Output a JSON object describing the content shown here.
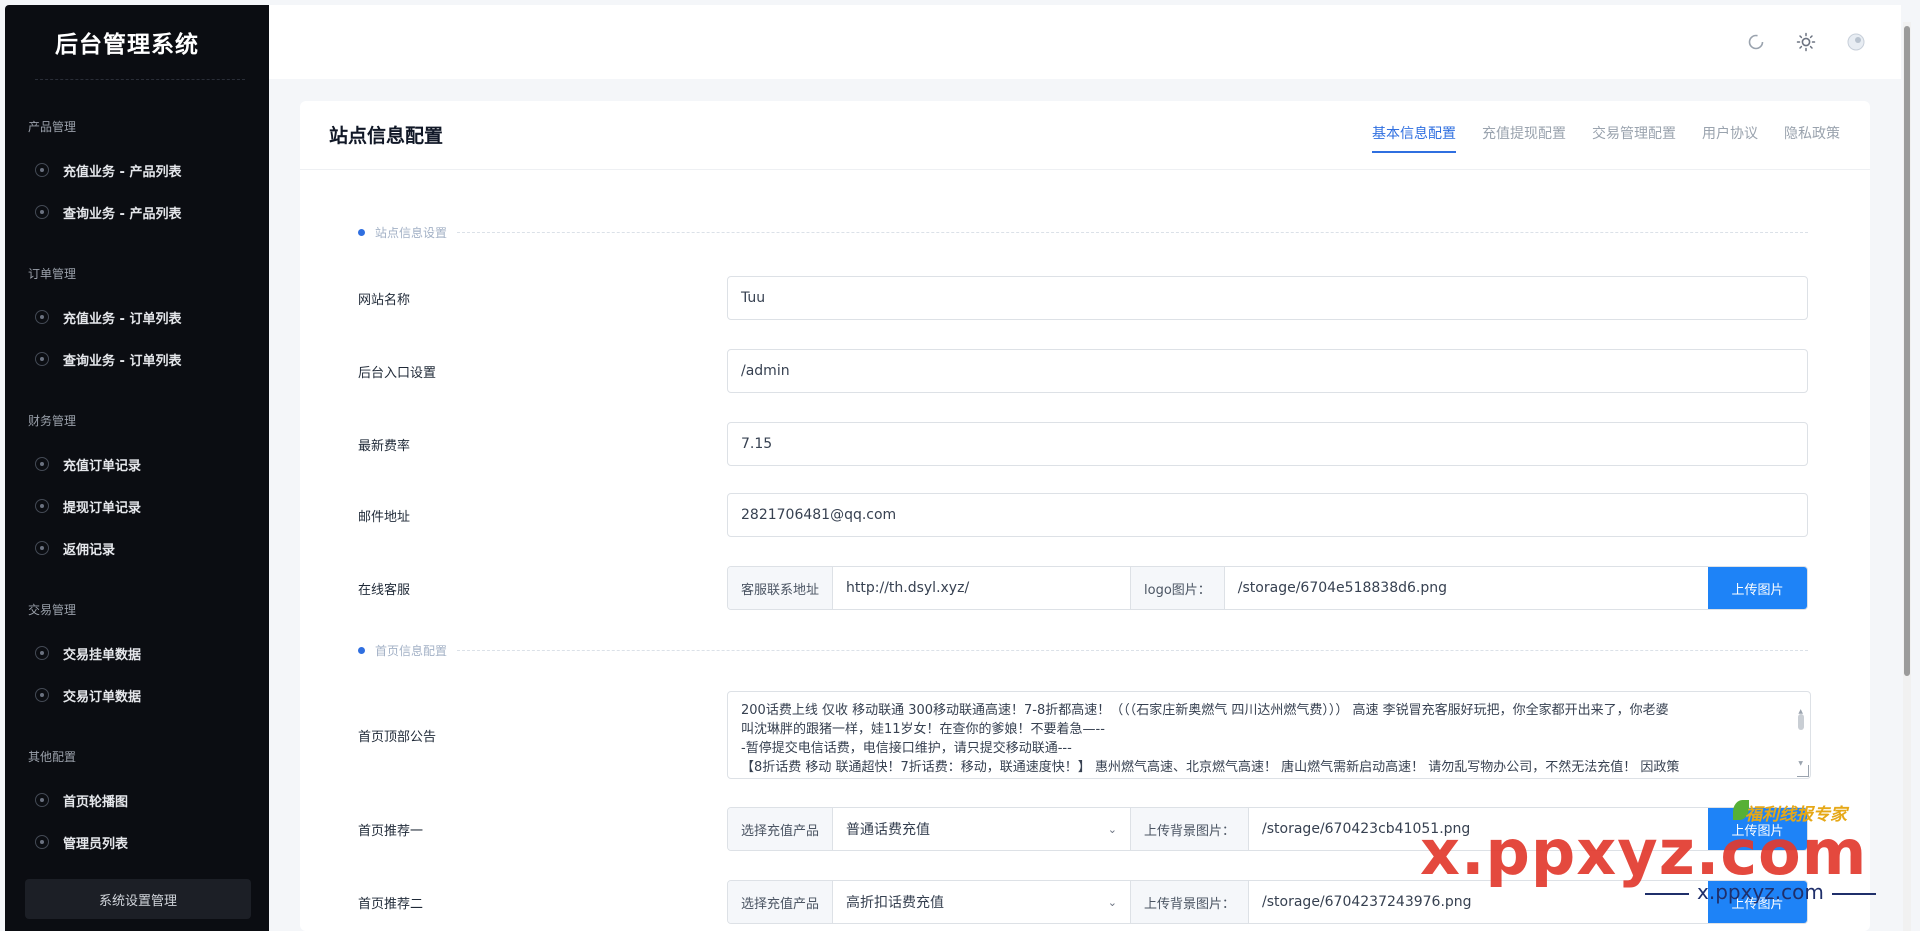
{
  "sidebar": {
    "brand": "后台管理系统",
    "groups": [
      {
        "title": "产品管理",
        "items": [
          "充值业务 - 产品列表",
          "查询业务 - 产品列表"
        ]
      },
      {
        "title": "订单管理",
        "items": [
          "充值业务 - 订单列表",
          "查询业务 - 订单列表"
        ]
      },
      {
        "title": "财务管理",
        "items": [
          "充值订单记录",
          "提现订单记录",
          "返佣记录"
        ]
      },
      {
        "title": "交易管理",
        "items": [
          "交易挂单数据",
          "交易订单数据"
        ]
      },
      {
        "title": "其他配置",
        "items": [
          "首页轮播图",
          "管理员列表"
        ]
      }
    ],
    "system_button": "系统设置管理"
  },
  "header": {
    "icons": [
      "refresh-icon",
      "sun-icon",
      "avatar-icon"
    ]
  },
  "card": {
    "title": "站点信息配置",
    "tabs": [
      "基本信息配置",
      "充值提现配置",
      "交易管理配置",
      "用户协议",
      "隐私政策"
    ],
    "active_tab": "基本信息配置"
  },
  "sections": {
    "site": "站点信息设置",
    "home": "首页信息配置"
  },
  "fields": {
    "site_name": {
      "label": "网站名称",
      "value": "Tuu"
    },
    "admin_entry": {
      "label": "后台入口设置",
      "value": "/admin"
    },
    "rate": {
      "label": "最新费率",
      "value": "7.15"
    },
    "email": {
      "label": "邮件地址",
      "value": "2821706481@qq.com"
    },
    "support": {
      "label": "在线客服",
      "addon1": "客服联系地址",
      "url": "http://th.dsyl.xyz/",
      "addon2": "logo图片：",
      "logo_path": "/storage/6704e518838d6.png",
      "upload": "上传图片"
    },
    "notice": {
      "label": "首页顶部公告",
      "lines": [
        "200话费上线 仅收 移动联通 300移动联通高速！7-8折都高速！（（（石家庄新奥燃气 四川达州燃气费））） 高速 李锐冒充客服好玩把，你全家都开出来了，你老婆",
        "叫沈琳胖的跟猪一样，娃11岁女！在查你的爹娘！不要着急—--",
        "-暂停提交电信话费，电信接口维护，请只提交移动联通---",
        "【8折话费 移动 联通超快！7折话费：移动，联通速度快！】 惠州燃气高速、北京燃气高速！ 唐山燃气需新启动高速！ 请勿乱写物办公司，不然无法充值！ 因政策"
      ]
    },
    "rec1": {
      "label": "首页推荐一",
      "addon1": "选择充值产品",
      "selected": "普通话费充值",
      "addon2": "上传背景图片：",
      "path": "/storage/670423cb41051.png",
      "upload": "上传图片"
    },
    "rec2": {
      "label": "首页推荐二",
      "addon1": "选择充值产品",
      "selected": "高折扣话费充值",
      "addon2": "上传背景图片：",
      "path": "/storage/6704237243976.png",
      "upload": "上传图片"
    }
  },
  "watermark": {
    "main": "x.ppxyz.com",
    "sub": "x.ppxyz.com",
    "tag": "福利线报专家"
  },
  "colors": {
    "accent": "#2f6fe0",
    "button": "#1e83f7",
    "sidebar_bg": "#0b0d12"
  }
}
